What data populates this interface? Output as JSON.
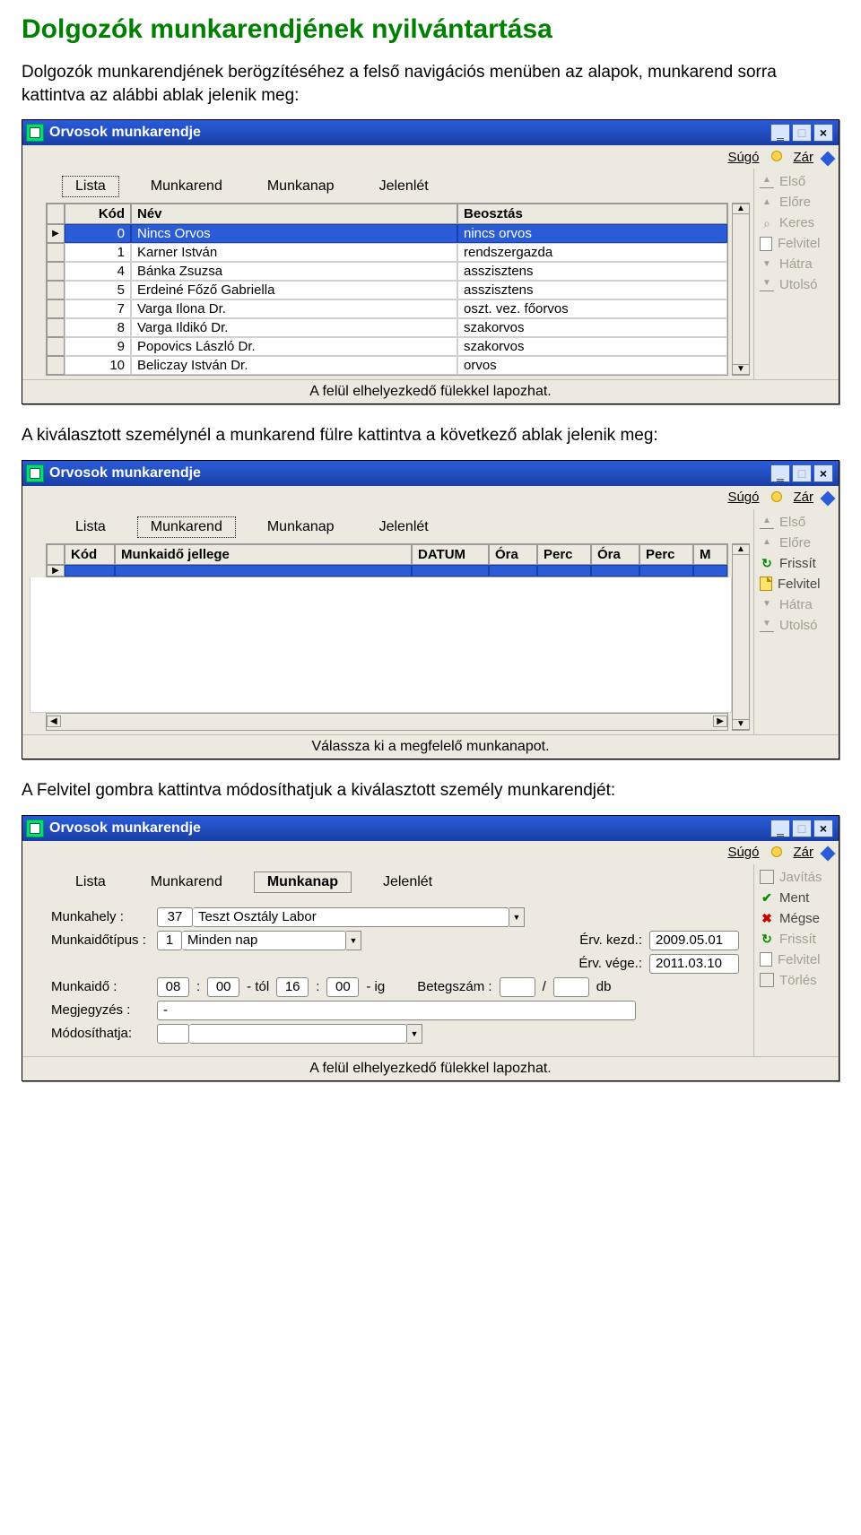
{
  "page": {
    "title": "Dolgozók munkarendjének nyilvántartása",
    "intro": "Dolgozók munkarendjének berögzítéséhez a felső navigációs menüben az alapok, munkarend sorra kattintva az alábbi ablak jelenik meg:",
    "mid": "A kiválasztott személynél a munkarend fülre kattintva a következő ablak jelenik meg:",
    "after2": "A Felvitel gombra kattintva módosíthatjuk a kiválasztott személy munkarendjét:"
  },
  "tb": {
    "sugo": "Súgó",
    "zar": "Zár"
  },
  "side": {
    "elso": "Első",
    "elore": "Előre",
    "keres": "Keres",
    "felvitel": "Felvitel",
    "hatra": "Hátra",
    "utolso": "Utolsó",
    "frissit": "Frissít",
    "javitas": "Javítás",
    "ment": "Ment",
    "megse": "Mégse",
    "torles": "Törlés"
  },
  "tabs": {
    "lista": "Lista",
    "munkarend": "Munkarend",
    "munkanap": "Munkanap",
    "jelenlet": "Jelenlét"
  },
  "win": {
    "title": "Orvosok munkarendje"
  },
  "win1": {
    "cols": {
      "kod": "Kód",
      "nev": "Név",
      "beosztas": "Beosztás"
    },
    "rows": [
      {
        "kod": "0",
        "nev": "Nincs Orvos",
        "beo": "nincs orvos"
      },
      {
        "kod": "1",
        "nev": "Karner István",
        "beo": "rendszergazda"
      },
      {
        "kod": "4",
        "nev": "Bánka Zsuzsa",
        "beo": "asszisztens"
      },
      {
        "kod": "5",
        "nev": "Erdeiné Főző Gabriella",
        "beo": "asszisztens"
      },
      {
        "kod": "7",
        "nev": "Varga Ilona Dr.",
        "beo": "oszt. vez. főorvos"
      },
      {
        "kod": "8",
        "nev": "Varga Ildikó Dr.",
        "beo": "szakorvos"
      },
      {
        "kod": "9",
        "nev": "Popovics László Dr.",
        "beo": "szakorvos"
      },
      {
        "kod": "10",
        "nev": "Beliczay István Dr.",
        "beo": "orvos"
      }
    ],
    "status": "A felül elhelyezkedő fülekkel lapozhat."
  },
  "win2": {
    "cols": {
      "kod": "Kód",
      "jel": "Munkaidő jellege",
      "datum": "DATUM",
      "ora": "Óra",
      "perc": "Perc",
      "ora2": "Óra",
      "perc2": "Perc",
      "m": "M"
    },
    "status": "Válassza ki a megfelelő munkanapot."
  },
  "win3": {
    "labels": {
      "munkahely": "Munkahely :",
      "munkaidotipus": "Munkaidőtípus :",
      "ervkezd": "Érv. kezd.:",
      "ervvege": "Érv. vége.:",
      "munkaido": "Munkaidő :",
      "betegszam": "Betegszám :",
      "megjegyzes": "Megjegyzés :",
      "modosithatja": "Módosíthatja:",
      "tol": "- tól",
      "ig": "- ig",
      "db": "db",
      "slash": "/"
    },
    "values": {
      "mh_kod": "37",
      "mh_nev": "Teszt Osztály Labor",
      "mt_kod": "1",
      "mt_nev": "Minden nap",
      "ervkezd": "2009.05.01",
      "ervvege": "2011.03.10",
      "m_h1": "08",
      "m_m1": "00",
      "m_h2": "16",
      "m_m2": "00",
      "bsz1": "",
      "bsz2": "",
      "megj": "-",
      "mod": ""
    },
    "status": "A felül elhelyezkedő fülekkel lapozhat."
  }
}
